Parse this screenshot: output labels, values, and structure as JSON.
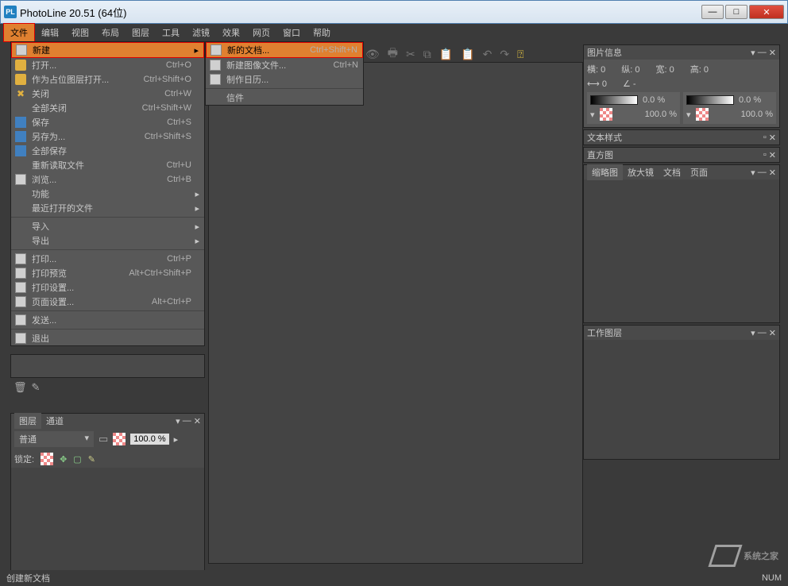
{
  "title": "PhotoLine 20.51 (64位)",
  "menubar": [
    "文件",
    "编辑",
    "视图",
    "布局",
    "图层",
    "工具",
    "滤镜",
    "效果",
    "网页",
    "窗口",
    "帮助"
  ],
  "file_menu": [
    {
      "label": "新建",
      "shortcut": "",
      "arrow": true,
      "highlight": true,
      "icon": "doc"
    },
    {
      "label": "打开...",
      "shortcut": "Ctrl+O",
      "icon": "folder"
    },
    {
      "label": "作为占位图层打开...",
      "shortcut": "Ctrl+Shift+O",
      "icon": "folder"
    },
    {
      "label": "关闭",
      "shortcut": "Ctrl+W",
      "icon": "close"
    },
    {
      "label": "全部关闭",
      "shortcut": "Ctrl+Shift+W"
    },
    {
      "label": "保存",
      "shortcut": "Ctrl+S",
      "icon": "save"
    },
    {
      "label": "另存为...",
      "shortcut": "Ctrl+Shift+S",
      "icon": "save"
    },
    {
      "label": "全部保存",
      "icon": "save"
    },
    {
      "label": "重新读取文件",
      "shortcut": "Ctrl+U"
    },
    {
      "label": "浏览...",
      "shortcut": "Ctrl+B",
      "icon": "browse"
    },
    {
      "label": "功能",
      "arrow": true
    },
    {
      "label": "最近打开的文件",
      "arrow": true
    },
    {
      "sep": true
    },
    {
      "label": "导入",
      "arrow": true
    },
    {
      "label": "导出",
      "arrow": true
    },
    {
      "sep": true
    },
    {
      "label": "打印...",
      "shortcut": "Ctrl+P",
      "icon": "print"
    },
    {
      "label": "打印预览",
      "shortcut": "Alt+Ctrl+Shift+P",
      "icon": "print"
    },
    {
      "label": "打印设置...",
      "icon": "print"
    },
    {
      "label": "页面设置...",
      "shortcut": "Alt+Ctrl+P",
      "icon": "print"
    },
    {
      "sep": true
    },
    {
      "label": "发送...",
      "icon": "send"
    },
    {
      "sep": true
    },
    {
      "label": "退出",
      "icon": "exit"
    }
  ],
  "submenu": [
    {
      "label": "新的文档...",
      "shortcut": "Ctrl+Shift+N",
      "highlight": true,
      "icon": "doc-a"
    },
    {
      "label": "新建图像文件...",
      "shortcut": "Ctrl+N",
      "icon": "doc"
    },
    {
      "label": "制作日历...",
      "icon": "cal"
    },
    {
      "sep": true
    },
    {
      "label": "信件"
    }
  ],
  "panels": {
    "image_info": {
      "title": "图片信息",
      "h": "横: 0",
      "v": "纵: 0",
      "w": "宽: 0",
      "ht": "高: 0",
      "pct1": "0.0 %",
      "pct2": "100.0 %",
      "pct3": "0.0 %",
      "pct4": "100.0 %"
    },
    "text_style": "文本样式",
    "histogram": "直方图",
    "thumbs": {
      "tabs": [
        "缩略图",
        "放大镜",
        "文档",
        "页面"
      ]
    },
    "work_layer": "工作图层"
  },
  "layers": {
    "tabs": [
      "图层",
      "通道"
    ],
    "mode": "普通",
    "opacity": "100.0 %",
    "lock_label": "锁定:"
  },
  "statusbar": {
    "left": "创建新文档",
    "right": [
      "NUM"
    ]
  },
  "watermark": "系统之家"
}
